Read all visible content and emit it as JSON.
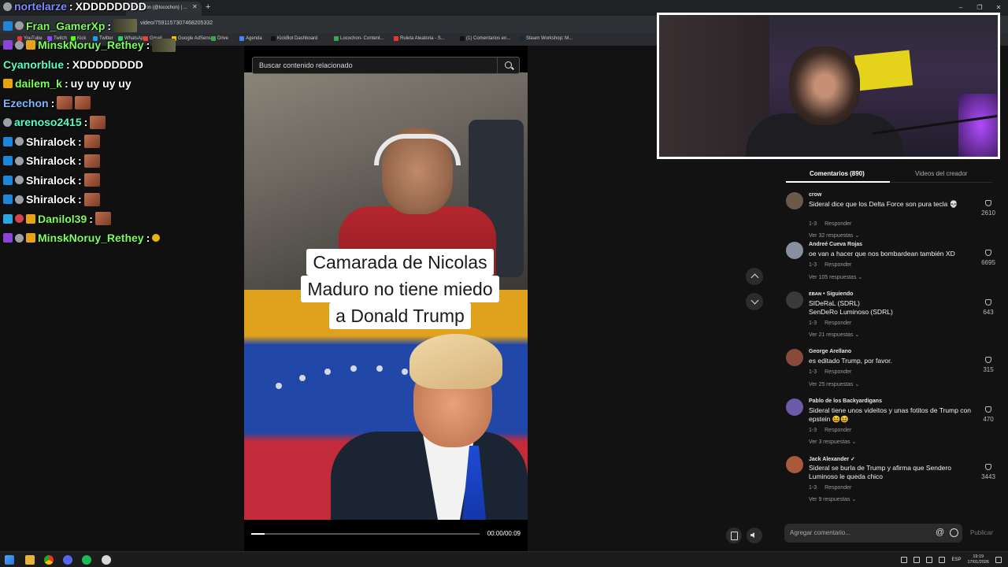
{
  "browser": {
    "tab_title": "Locochon (@locochon) | ...",
    "url": "video/7591157307468205332",
    "bookmarks": [
      {
        "label": "YouTube",
        "color": "#e33"
      },
      {
        "label": "Twitch",
        "color": "#9146ff"
      },
      {
        "label": "Kick",
        "color": "#53fc18"
      },
      {
        "label": "Twitter",
        "color": "#1d9bf0"
      },
      {
        "label": "WhatsApp",
        "color": "#25d366"
      },
      {
        "label": "Gmail",
        "color": "#ea4335"
      },
      {
        "label": "Google AdSense",
        "color": "#fbbc05"
      },
      {
        "label": "Drive",
        "color": "#34a853"
      },
      {
        "label": "Agenda",
        "color": "#4285f4"
      },
      {
        "label": "KickBot Dashboard",
        "color": "#111"
      },
      {
        "label": "Locochon- Content...",
        "color": "#34a853"
      },
      {
        "label": "Ruleta Aleatoria - S...",
        "color": "#e33"
      },
      {
        "label": "(1) Comentarios en...",
        "color": "#111"
      },
      {
        "label": "Steam Workshop::M...",
        "color": "#1b2838"
      }
    ]
  },
  "chat": [
    {
      "user": "nortelarze",
      "color": "#7b8cff",
      "badges": [
        "wolf"
      ],
      "message": "XDDDDDDDD",
      "emotes": []
    },
    {
      "user": "Fran_GamerXp",
      "color": "#7dff5a",
      "badges": [
        "blue",
        "wolf"
      ],
      "message": "",
      "emotes": [
        "dark"
      ]
    },
    {
      "user": "MinskNoruy_Rethey",
      "color": "#7dff5a",
      "badges": [
        "purple",
        "wolf",
        "crown"
      ],
      "message": "",
      "emotes": [
        "dark"
      ]
    },
    {
      "user": "Cyanorblue",
      "color": "#5affc8",
      "badges": [],
      "message": "XDDDDDDDD",
      "emotes": []
    },
    {
      "user": "dailem_k",
      "color": "#7dff5a",
      "badges": [
        "crown"
      ],
      "message": "uy uy uy uy",
      "emotes": []
    },
    {
      "user": "Ezechon",
      "color": "#7ab8ff",
      "badges": [],
      "message": "",
      "emotes": [
        "face",
        "face"
      ]
    },
    {
      "user": "arenoso2415",
      "color": "#5affc8",
      "badges": [
        "wolf"
      ],
      "message": "",
      "emotes": [
        "face"
      ]
    },
    {
      "user": "Shiralock",
      "color": "#ffffff",
      "badges": [
        "blue",
        "wolf"
      ],
      "message": "",
      "emotes": [
        "face"
      ]
    },
    {
      "user": "Shiralock",
      "color": "#ffffff",
      "badges": [
        "blue",
        "wolf"
      ],
      "message": "",
      "emotes": [
        "face"
      ]
    },
    {
      "user": "Shiralock",
      "color": "#ffffff",
      "badges": [
        "blue",
        "wolf"
      ],
      "message": "",
      "emotes": [
        "face"
      ]
    },
    {
      "user": "Shiralock",
      "color": "#ffffff",
      "badges": [
        "blue",
        "wolf"
      ],
      "message": "",
      "emotes": [
        "face"
      ]
    },
    {
      "user": "Danilol39",
      "color": "#7dff5a",
      "badges": [
        "cube",
        "heart",
        "crown"
      ],
      "message": "",
      "emotes": [
        "face"
      ]
    },
    {
      "user": "MinskNoruy_Rethey",
      "color": "#7dff5a",
      "badges": [
        "purple",
        "wolf",
        "crown"
      ],
      "message": "",
      "emotes": [
        "small"
      ]
    }
  ],
  "search": {
    "placeholder": "Buscar contenido relacionado"
  },
  "video": {
    "caption_lines": [
      "Camarada de Nicolas",
      "Maduro no tiene miedo",
      "a Donald Trump"
    ],
    "time": "00:00/00:09",
    "progress": 0.06
  },
  "comments_panel": {
    "tab_comments": "Comentarios (890)",
    "tab_creator": "Videos del creador",
    "reply_label": "Responder",
    "comments": [
      {
        "user": "crow",
        "text": "Sideral dice que los Delta Force son pura tecla 💀",
        "date": "1-3",
        "more": "Ver 32 respuestas",
        "likes": "2610",
        "avatar": "#6b5a4a"
      },
      {
        "user": "Andreé Cueva Rojas",
        "text": "oe van a hacer que nos bombardean también XD",
        "date": "1-3",
        "more": "Ver 105 respuestas",
        "likes": "6695",
        "avatar": "#8a8fa0"
      },
      {
        "user": "ᴇʙᴀɴ • Siguiendo",
        "text": "SIDeRaL (SDRL)\nSenDeRo Luminoso (SDRL)",
        "date": "1-3",
        "more": "Ver 21 respuestas",
        "likes": "643",
        "avatar": "#3a3a3a"
      },
      {
        "user": "George Arellano",
        "text": "es editado Trump, por favor.",
        "date": "1-3",
        "more": "Ver 25 respuestas",
        "likes": "315",
        "avatar": "#8a4a3a"
      },
      {
        "user": "Pablo de los Backyardigans",
        "text": "Sideral tiene unos videitos y unas fotitos de Trump con epstein 😆😆",
        "date": "1-3",
        "more": "Ver 3 respuestas",
        "likes": "470",
        "avatar": "#6a5aa8"
      },
      {
        "user": "Jack Alexander ✓",
        "text": "Sideral se burla de Trump y afirma que Sendero Luminoso le queda chico",
        "date": "1-3",
        "more": "Ver 9 respuestas",
        "likes": "3443",
        "avatar": "#a85a3a"
      }
    ],
    "input_placeholder": "Agregar comentario...",
    "at_symbol": "@",
    "publish": "Publicar"
  },
  "taskbar": {
    "lang": "ESP",
    "time": "19:19",
    "date": "17/01/2026"
  }
}
